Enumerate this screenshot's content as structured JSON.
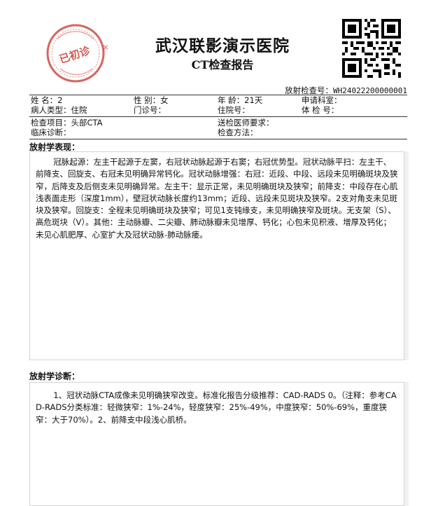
{
  "header": {
    "hospital_name": "武汉联影演示医院",
    "report_title": "CT检查报告",
    "stamp_text": "已初诊",
    "exam_no_label": "放射检查号：",
    "exam_no_value": "WH24022200000001"
  },
  "patient": {
    "name_label": "姓  名：",
    "name_value": "2",
    "sex_label": "性  别：",
    "sex_value": "女",
    "age_label": "年  龄：",
    "age_value": "21天",
    "dept_label": "申请科室：",
    "dept_value": "",
    "type_label": "病人类型：",
    "type_value": "住院",
    "outpatient_label": "门诊号：",
    "outpatient_value": "",
    "inpatient_label": "住院号：",
    "inpatient_value": "",
    "physical_label": "体  检  号：",
    "physical_value": "",
    "item_label": "检查项目：",
    "item_value": "头部CTA",
    "doctor_req_label": "送检医师要求：",
    "doctor_req_value": "",
    "clinical_label": "临床诊断：",
    "clinical_value": "",
    "method_label": "检查方法：",
    "method_value": ""
  },
  "findings": {
    "title": "放射学表现：",
    "text": "冠脉起源：左主干起源于左窦，右冠状动脉起源于右窦；右冠优势型。冠状动脉平扫：左主干、前降支、回旋支、右冠未见明确异常钙化。冠状动脉增强：右冠：近段、中段、远段未见明确斑块及狭窄，后降支及后侧支未见明确异常。左主干：显示正常，未见明确斑块及狭窄；前降支：中段存在心肌浅表面走形（深度1mm），壁冠状动脉长度约13mm；近段、远段未见斑块及狭窄。2支对角支未见斑块及狭窄。回旋支：全程未见明确斑块及狭窄；可见1支钝缘支，未见明确狭窄及斑块。无支架（S）、高危斑块（V）。其他：主动脉瓣、二尖瓣、肺动脉瓣未见增厚、钙化；心包未见积液、增厚及钙化；未见心肌肥厚、心室扩大及冠状动脉-肺动脉瘘。"
  },
  "diagnosis": {
    "title": "放射学诊断：",
    "text": "1、冠状动脉CTA成像未见明确狭窄改变。标准化报告分级推荐：CAD-RADS  0。（注释：参考CAD-RADS分类标准：轻微狭窄：1%-24%，轻度狭窄：25%-49%，中度狭窄：50%-69%，重度狭窄：大于70%）。2、前降支中段浅心肌桥。"
  },
  "colors": {
    "stamp_red": "#c8302a",
    "border": "#d4d4d4",
    "text": "#111111"
  }
}
